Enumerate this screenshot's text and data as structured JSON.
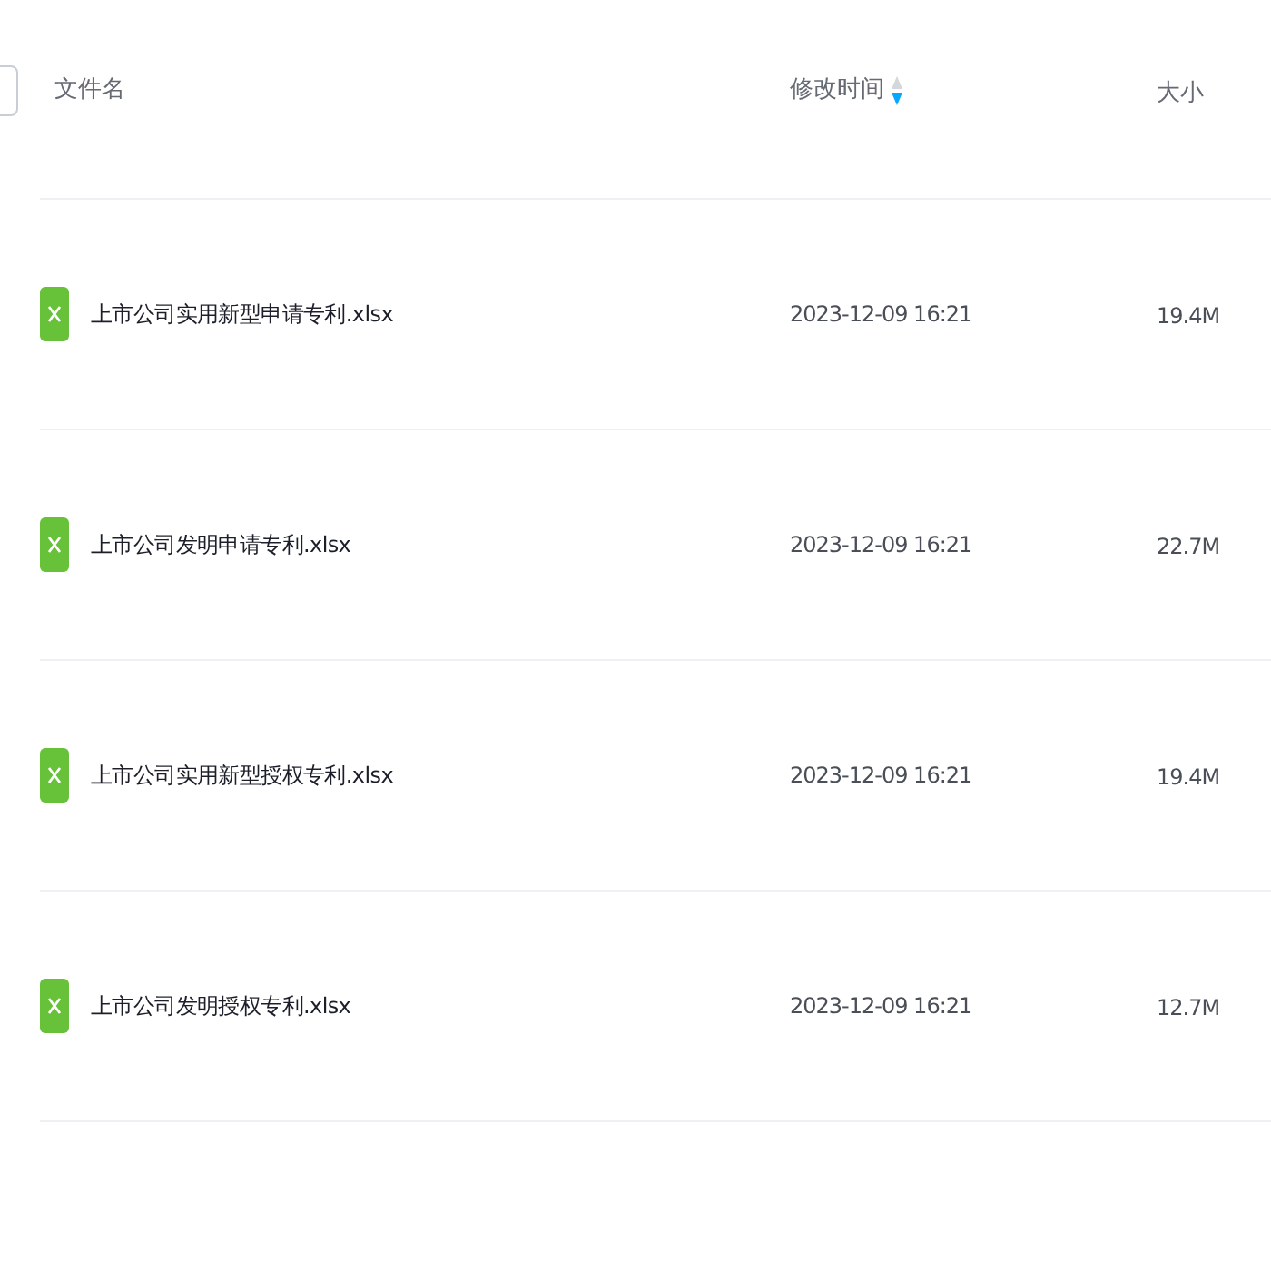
{
  "table": {
    "select_all": {
      "checked": false
    },
    "columns": [
      {
        "label": "文件名"
      },
      {
        "label": "修改时间",
        "sorted_descending": true
      },
      {
        "label": "大小"
      }
    ],
    "rows": [
      {
        "name": "上市公司实用新型申请专利.xlsx",
        "modified": "2023-12-09 16:21",
        "size": "19.4M"
      },
      {
        "name": "上市公司发明申请专利.xlsx",
        "modified": "2023-12-09 16:21",
        "size": "22.7M"
      },
      {
        "name": "上市公司实用新型授权专利.xlsx",
        "modified": "2023-12-09 16:21",
        "size": "19.4M"
      },
      {
        "name": "上市公司发明授权专利.xlsx",
        "modified": "2023-12-09 16:21",
        "size": "12.7M"
      }
    ]
  }
}
